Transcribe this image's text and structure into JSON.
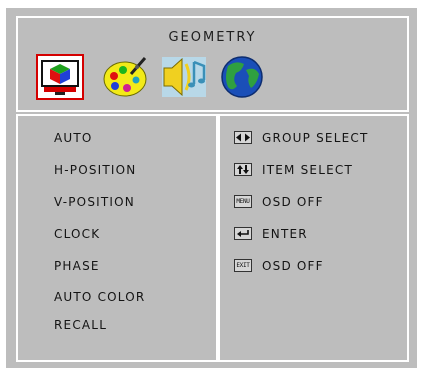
{
  "header": {
    "title": "GEOMETRY",
    "icons": [
      {
        "name": "geometry-icon",
        "selected": true
      },
      {
        "name": "color-palette-icon",
        "selected": false
      },
      {
        "name": "audio-icon",
        "selected": false
      },
      {
        "name": "globe-icon",
        "selected": false
      }
    ]
  },
  "menu": {
    "items": [
      "AUTO",
      "H-POSITION",
      "V-POSITION",
      "CLOCK",
      "PHASE",
      "AUTO COLOR",
      "RECALL"
    ]
  },
  "help": {
    "group_select": {
      "key_icon": "left-right-arrows-icon",
      "label": "GROUP SELECT"
    },
    "item_select": {
      "key_icon": "up-down-arrows-icon",
      "label": "ITEM SELECT"
    },
    "menu": {
      "key": "MENU",
      "label": "OSD OFF"
    },
    "enter": {
      "key_icon": "enter-arrow-icon",
      "label": "ENTER"
    },
    "exit": {
      "key": "EXIT",
      "label": "OSD OFF"
    }
  },
  "colors": {
    "panel_bg": "#bdbdbd",
    "border": "#ffffff",
    "selected_border": "#d40000",
    "text": "#141414"
  }
}
